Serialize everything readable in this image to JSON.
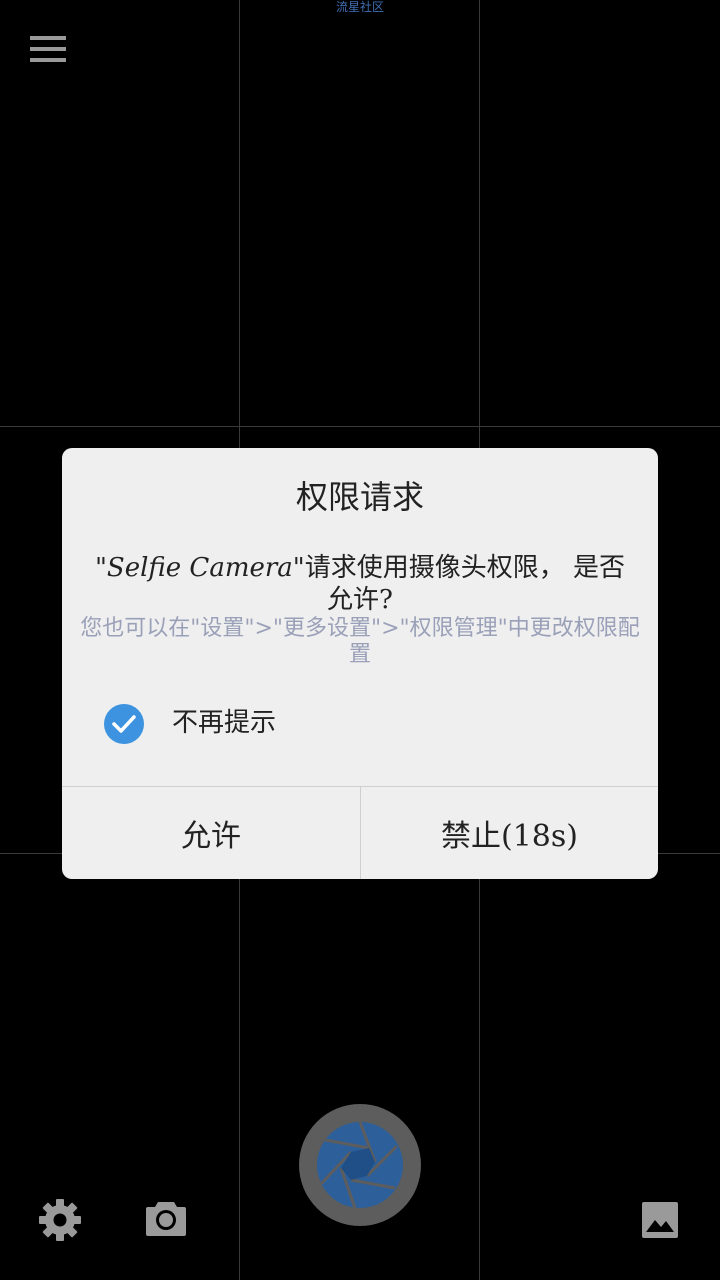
{
  "watermark": "流星社区",
  "dialog": {
    "title": "权限请求",
    "message_prefix": "\"",
    "app_name": "Selfie Camera",
    "message_suffix": "\"请求使用摄像头权限， 是否允许?",
    "hint": "您也可以在\"设置\">\"更多设置\">\"权限管理\"中更改权限配置",
    "checkbox_label": "不再提示",
    "checkbox_checked": true,
    "allow_label": "允许",
    "deny_label": "禁止(18s)"
  },
  "icons": {
    "menu": "menu-icon",
    "settings": "gear-icon",
    "camera": "camera-icon",
    "shutter": "shutter-icon",
    "gallery": "gallery-icon"
  },
  "colors": {
    "accent": "#3d93e0",
    "shutter_ring": "#5d5d5d",
    "shutter_core": "#2d5f9a",
    "icon_gray": "#9a9a9a",
    "hint_text": "#9aa0b8"
  }
}
